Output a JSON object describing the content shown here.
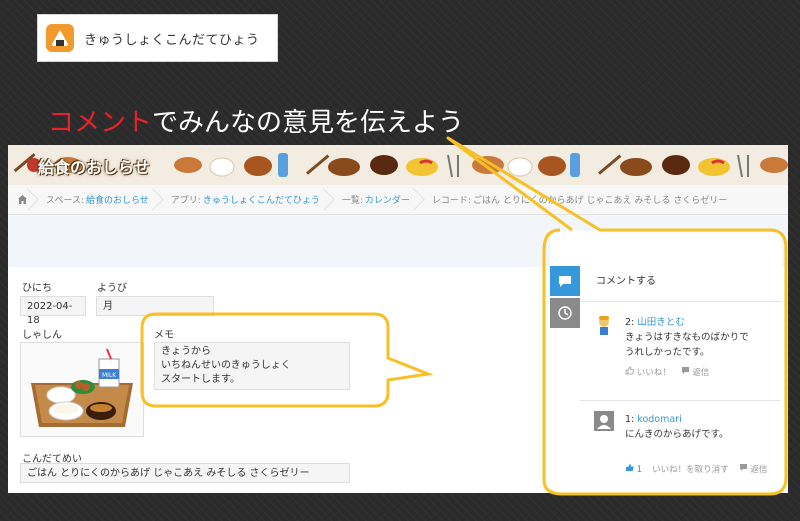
{
  "app_card": {
    "name": "きゅうしょくこんだてひょう"
  },
  "heading": {
    "accent": "コメント",
    "rest": "でみんなの意見を伝えよう"
  },
  "banner": {
    "title": "給食のおしらせ"
  },
  "breadcrumb": {
    "space_label": "スペース:",
    "space_value": "給食のおしらせ",
    "app_label": "アプリ:",
    "app_value": "きゅうしょくこんだてひょう",
    "list_label": "一覧:",
    "list_value": "カレンダー",
    "record_label": "レコード:",
    "record_value": "ごはん とりにくのからあげ じゃこあえ みそしる さくらゼリー"
  },
  "toolbar": {
    "icons": [
      "chevron-up-icon",
      "chevron-down-icon",
      "plus-icon",
      "edit-icon",
      "copy-icon",
      "more-icon"
    ]
  },
  "record": {
    "date_label": "ひにち",
    "date_value": "2022-04-18",
    "weekday_label": "ようび",
    "weekday_value": "月",
    "photo_label": "しゃしん",
    "memo_label": "メモ",
    "memo_lines": [
      "きょうから",
      "いちねんせいのきゅうしょく",
      "スタートします。"
    ],
    "menu_label": "こんだてめい",
    "menu_value": "ごはん とりにくのからあげ じゃこあえ みそしる さくらゼリー"
  },
  "comments": {
    "title": "コメントする",
    "items": [
      {
        "num": "2:",
        "user": "山田きとむ",
        "lines": [
          "きょうはすきなものばかりで",
          "うれしかったです。"
        ],
        "like": "いいね！",
        "reply": "返信"
      },
      {
        "num": "1:",
        "user": "kodomari",
        "lines": [
          "にんきのからあげです。"
        ],
        "like_count": "1",
        "like": "いいね！を取り消す",
        "reply": "返信"
      }
    ]
  },
  "colors": {
    "accent_red": "#e8212b",
    "highlight_yellow": "#f7c026",
    "link_blue": "#3498db",
    "tab_blue": "#3498db",
    "tab_gray": "#8a8a8a"
  }
}
